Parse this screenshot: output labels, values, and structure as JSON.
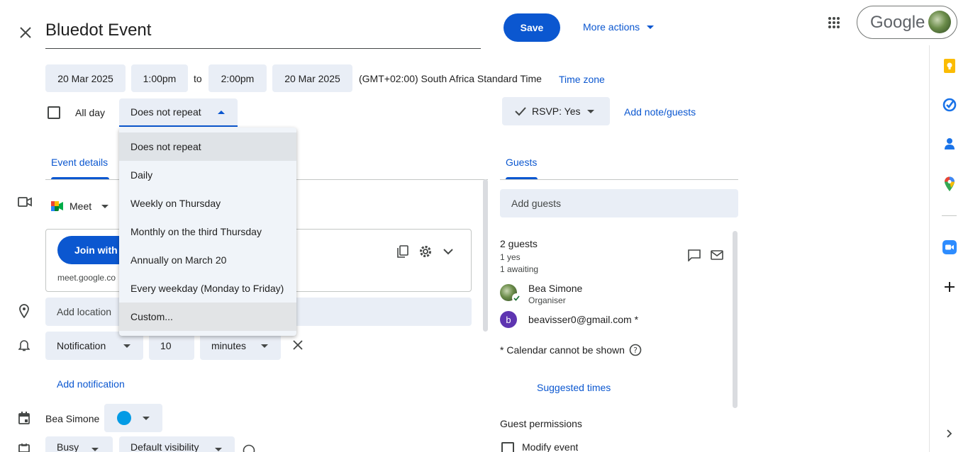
{
  "header": {
    "title": "Bluedot Event",
    "save_label": "Save",
    "more_actions_label": "More actions",
    "google_label": "Google"
  },
  "datetime": {
    "start_date": "20 Mar 2025",
    "start_time": "1:00pm",
    "to_label": "to",
    "end_time": "2:00pm",
    "end_date": "20 Mar 2025",
    "timezone_text": "(GMT+02:00) South Africa Standard Time",
    "timezone_link": "Time zone",
    "all_day_label": "All day",
    "repeat_selected": "Does not repeat"
  },
  "repeat_menu": {
    "options": [
      "Does not repeat",
      "Daily",
      "Weekly on Thursday",
      "Monthly on the third Thursday",
      "Annually on March 20",
      "Every weekday (Monday to Friday)",
      "Custom..."
    ]
  },
  "rsvp": {
    "label": "RSVP: Yes",
    "add_note_label": "Add note/guests"
  },
  "tabs": {
    "event_details": "Event details",
    "guests": "Guests"
  },
  "details": {
    "meet_label": "Meet",
    "join_label": "Join with",
    "meet_link": "meet.google.co",
    "location_placeholder": "Add location",
    "notification_type": "Notification",
    "notification_value": "10",
    "notification_unit": "minutes",
    "add_notification": "Add notification",
    "calendar_owner": "Bea Simone",
    "calendar_color": "#039be5",
    "busy_label": "Busy",
    "visibility_label": "Default visibility"
  },
  "guests": {
    "add_placeholder": "Add guests",
    "count": "2 guests",
    "yes_count": "1 yes",
    "awaiting_count": "1 awaiting",
    "list": [
      {
        "name": "Bea Simone",
        "role": "Organiser",
        "avatar": ""
      },
      {
        "name": "beavisser0@gmail.com *",
        "role": "",
        "avatar": "b"
      }
    ],
    "calendar_note": "* Calendar cannot be shown",
    "suggested_times": "Suggested times",
    "permissions_title": "Guest permissions",
    "modify_event": "Modify event"
  },
  "colors": {
    "accent": "#0b57d0",
    "chip_bg": "#e9eef6",
    "avatar_b": "#5e35b1"
  }
}
